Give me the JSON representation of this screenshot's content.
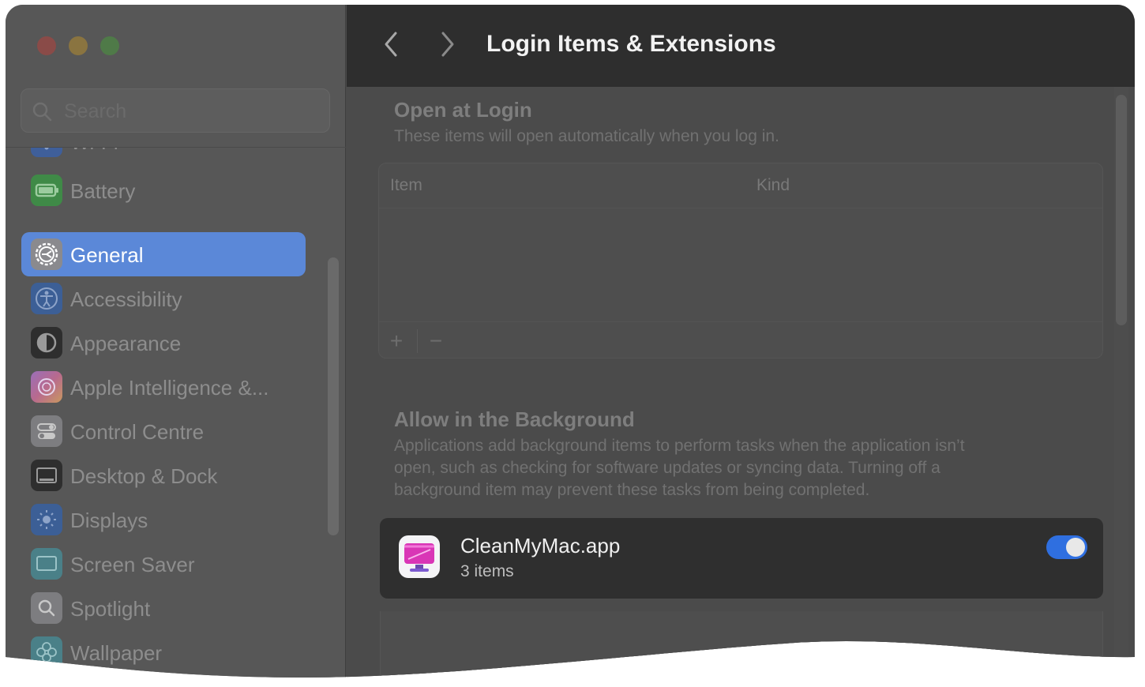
{
  "window": {
    "title": "Login Items & Extensions"
  },
  "sidebar": {
    "search_placeholder": "Search",
    "items": [
      {
        "label": "Wi-Fi",
        "icon": "wifi-icon",
        "color": "#3d6fd1"
      },
      {
        "label": "Battery",
        "icon": "battery-icon",
        "color": "#3f9a45"
      },
      {
        "label": "General",
        "icon": "gear-icon",
        "color": "#8e8e93",
        "selected": true
      },
      {
        "label": "Accessibility",
        "icon": "accessibility-icon",
        "color": "#2f6fd1"
      },
      {
        "label": "Appearance",
        "icon": "appearance-icon",
        "color": "#1c1c1e"
      },
      {
        "label": "Apple Intelligence &...",
        "icon": "apple-intelligence-icon",
        "color": "#c458c9"
      },
      {
        "label": "Control Centre",
        "icon": "control-centre-icon",
        "color": "#8e8e93"
      },
      {
        "label": "Desktop & Dock",
        "icon": "desktop-dock-icon",
        "color": "#1c1c1e"
      },
      {
        "label": "Displays",
        "icon": "displays-icon",
        "color": "#2f6fd1"
      },
      {
        "label": "Screen Saver",
        "icon": "screen-saver-icon",
        "color": "#3d9ea6"
      },
      {
        "label": "Spotlight",
        "icon": "spotlight-icon",
        "color": "#8e8e93"
      },
      {
        "label": "Wallpaper",
        "icon": "wallpaper-icon",
        "color": "#3d9ea6"
      }
    ]
  },
  "main": {
    "open_at_login": {
      "title": "Open at Login",
      "description": "These items will open automatically when you log in.",
      "columns": [
        "Item",
        "Kind"
      ],
      "add_label": "+",
      "remove_label": "−"
    },
    "background": {
      "title": "Allow in the Background",
      "description_lines": [
        "Applications add background items to perform tasks when the application isn’t",
        "open, such as checking for software updates or syncing data. Turning off a",
        "background item may prevent these tasks from being completed."
      ],
      "apps": [
        {
          "name": "CleanMyMac.app",
          "detail": "3 items",
          "enabled": true,
          "icon": "cleanmymac-icon"
        }
      ]
    }
  },
  "colors": {
    "accent": "#5b88d8",
    "toggle_on": "#2f6fe0"
  }
}
